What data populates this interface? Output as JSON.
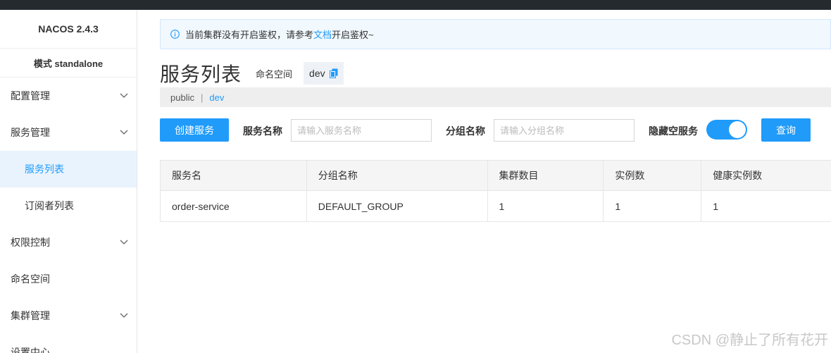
{
  "app": {
    "brand": "NACOS 2.4.3",
    "mode": "模式 standalone"
  },
  "sidebar": {
    "items": [
      {
        "label": "配置管理",
        "has_chevron": true
      },
      {
        "label": "服务管理",
        "has_chevron": true
      },
      {
        "label": "服务列表",
        "sub": true,
        "active": true
      },
      {
        "label": "订阅者列表",
        "sub": true
      },
      {
        "label": "权限控制",
        "has_chevron": true
      },
      {
        "label": "命名空间"
      },
      {
        "label": "集群管理",
        "has_chevron": true
      },
      {
        "label": "设置中心"
      }
    ]
  },
  "notice": {
    "prefix": "当前集群没有开启鉴权，请参考",
    "link": "文档",
    "suffix": "开启鉴权~"
  },
  "page": {
    "title": "服务列表",
    "namespace_label": "命名空间",
    "namespace_value": "dev"
  },
  "namespaces": {
    "public": "public",
    "separator": "|",
    "current": "dev"
  },
  "filters": {
    "create_button": "创建服务",
    "service_name_label": "服务名称",
    "service_name_placeholder": "请输入服务名称",
    "group_name_label": "分组名称",
    "group_name_placeholder": "请输入分组名称",
    "hide_empty_label": "隐藏空服务",
    "hide_empty_on": true,
    "query_button": "查询"
  },
  "table": {
    "headers": [
      "服务名",
      "分组名称",
      "集群数目",
      "实例数",
      "健康实例数"
    ],
    "rows": [
      [
        "order-service",
        "DEFAULT_GROUP",
        "1",
        "1",
        "1"
      ]
    ]
  },
  "watermark": "CSDN @静止了所有花开",
  "colors": {
    "accent": "#209bfa",
    "topbar": "#252a2f",
    "active_bg": "#e8f3fd"
  }
}
